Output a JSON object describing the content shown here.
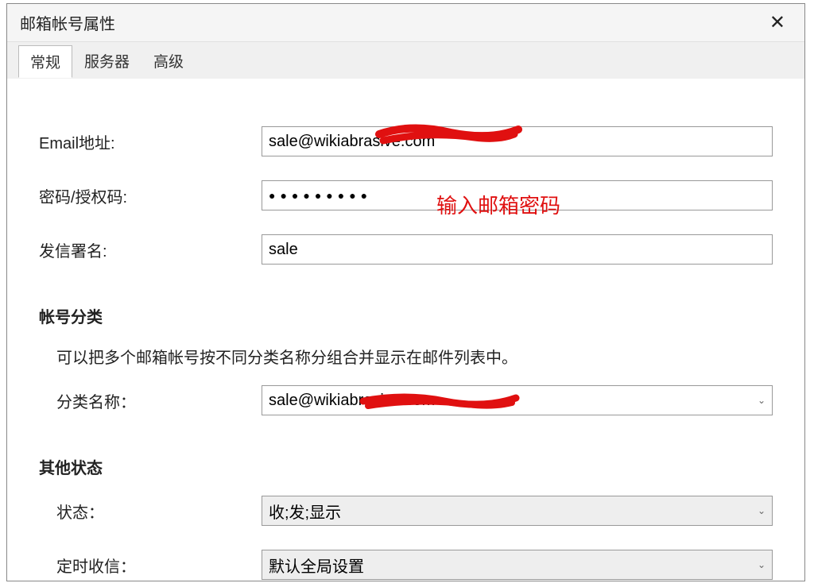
{
  "dialog": {
    "title": "邮箱帐号属性"
  },
  "tabs": {
    "general": "常规",
    "server": "服务器",
    "advanced": "高级"
  },
  "fields": {
    "email_label": "Email地址:",
    "email_value": "sale@wikiabrasive.com",
    "password_label": "密码/授权码:",
    "password_value": "●●●●●●●●●",
    "signature_label": "发信署名:",
    "signature_value": "sale"
  },
  "category": {
    "header": "帐号分类",
    "description": "可以把多个邮箱帐号按不同分类名称分组合并显示在邮件列表中。",
    "name_label": "分类名称：",
    "name_value": "sale@wikiabrasive.com"
  },
  "other": {
    "header": "其他状态",
    "status_label": "状态：",
    "status_value": "收;发;显示",
    "schedule_label": "定时收信：",
    "schedule_value": "默认全局设置"
  },
  "annotations": {
    "password_hint": "输入邮箱密码"
  },
  "icons": {
    "close": "✕",
    "chevron_down": "⌄"
  }
}
